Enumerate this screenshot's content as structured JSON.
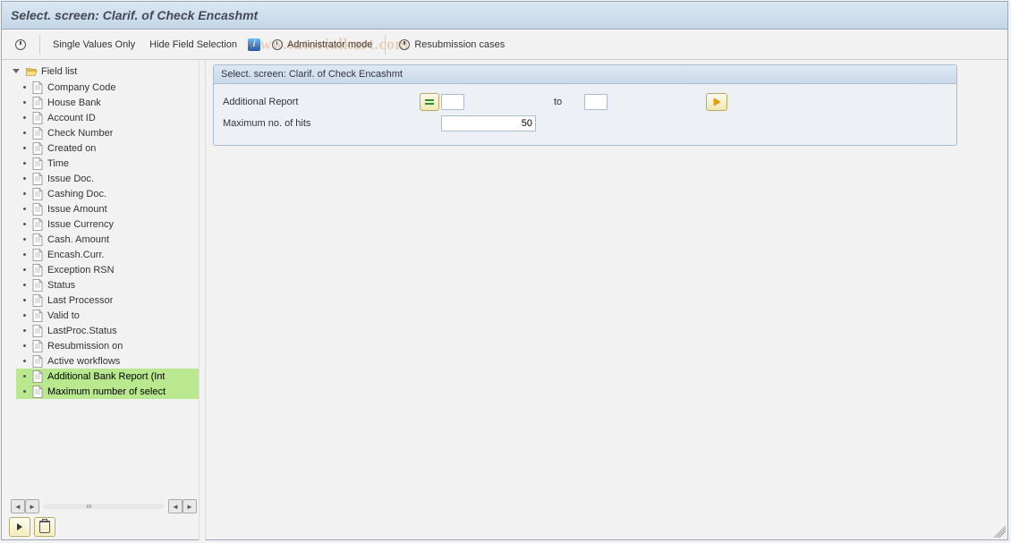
{
  "title": "Select. screen: Clarif. of Check Encashmt",
  "toolbar": {
    "single_values": "Single Values Only",
    "hide_field_sel": "Hide Field Selection",
    "admin_mode": "Administrator mode",
    "resubmission": "Resubmission cases"
  },
  "watermark": "www.tutorialkart.com",
  "sidebar": {
    "root": "Field list",
    "items": [
      {
        "label": "Company Code"
      },
      {
        "label": "House Bank"
      },
      {
        "label": "Account ID"
      },
      {
        "label": "Check Number"
      },
      {
        "label": "Created on"
      },
      {
        "label": "Time"
      },
      {
        "label": "Issue Doc."
      },
      {
        "label": "Cashing Doc."
      },
      {
        "label": "Issue Amount"
      },
      {
        "label": "Issue Currency"
      },
      {
        "label": "Cash. Amount"
      },
      {
        "label": "Encash.Curr."
      },
      {
        "label": "Exception RSN"
      },
      {
        "label": "Status"
      },
      {
        "label": "Last Processor"
      },
      {
        "label": "Valid to"
      },
      {
        "label": "LastProc.Status"
      },
      {
        "label": "Resubmission on"
      },
      {
        "label": "Active workflows"
      },
      {
        "label": "Additional Bank Report (Int",
        "selected": true
      },
      {
        "label": "Maximum number of select",
        "selected": true
      }
    ]
  },
  "panel": {
    "header": "Select. screen: Clarif. of Check Encashmt",
    "rows": {
      "additional_report": {
        "label": "Additional Report",
        "from": "",
        "to_label": "to",
        "to": ""
      },
      "max_hits": {
        "label": "Maximum no. of hits",
        "value": "50"
      }
    }
  }
}
